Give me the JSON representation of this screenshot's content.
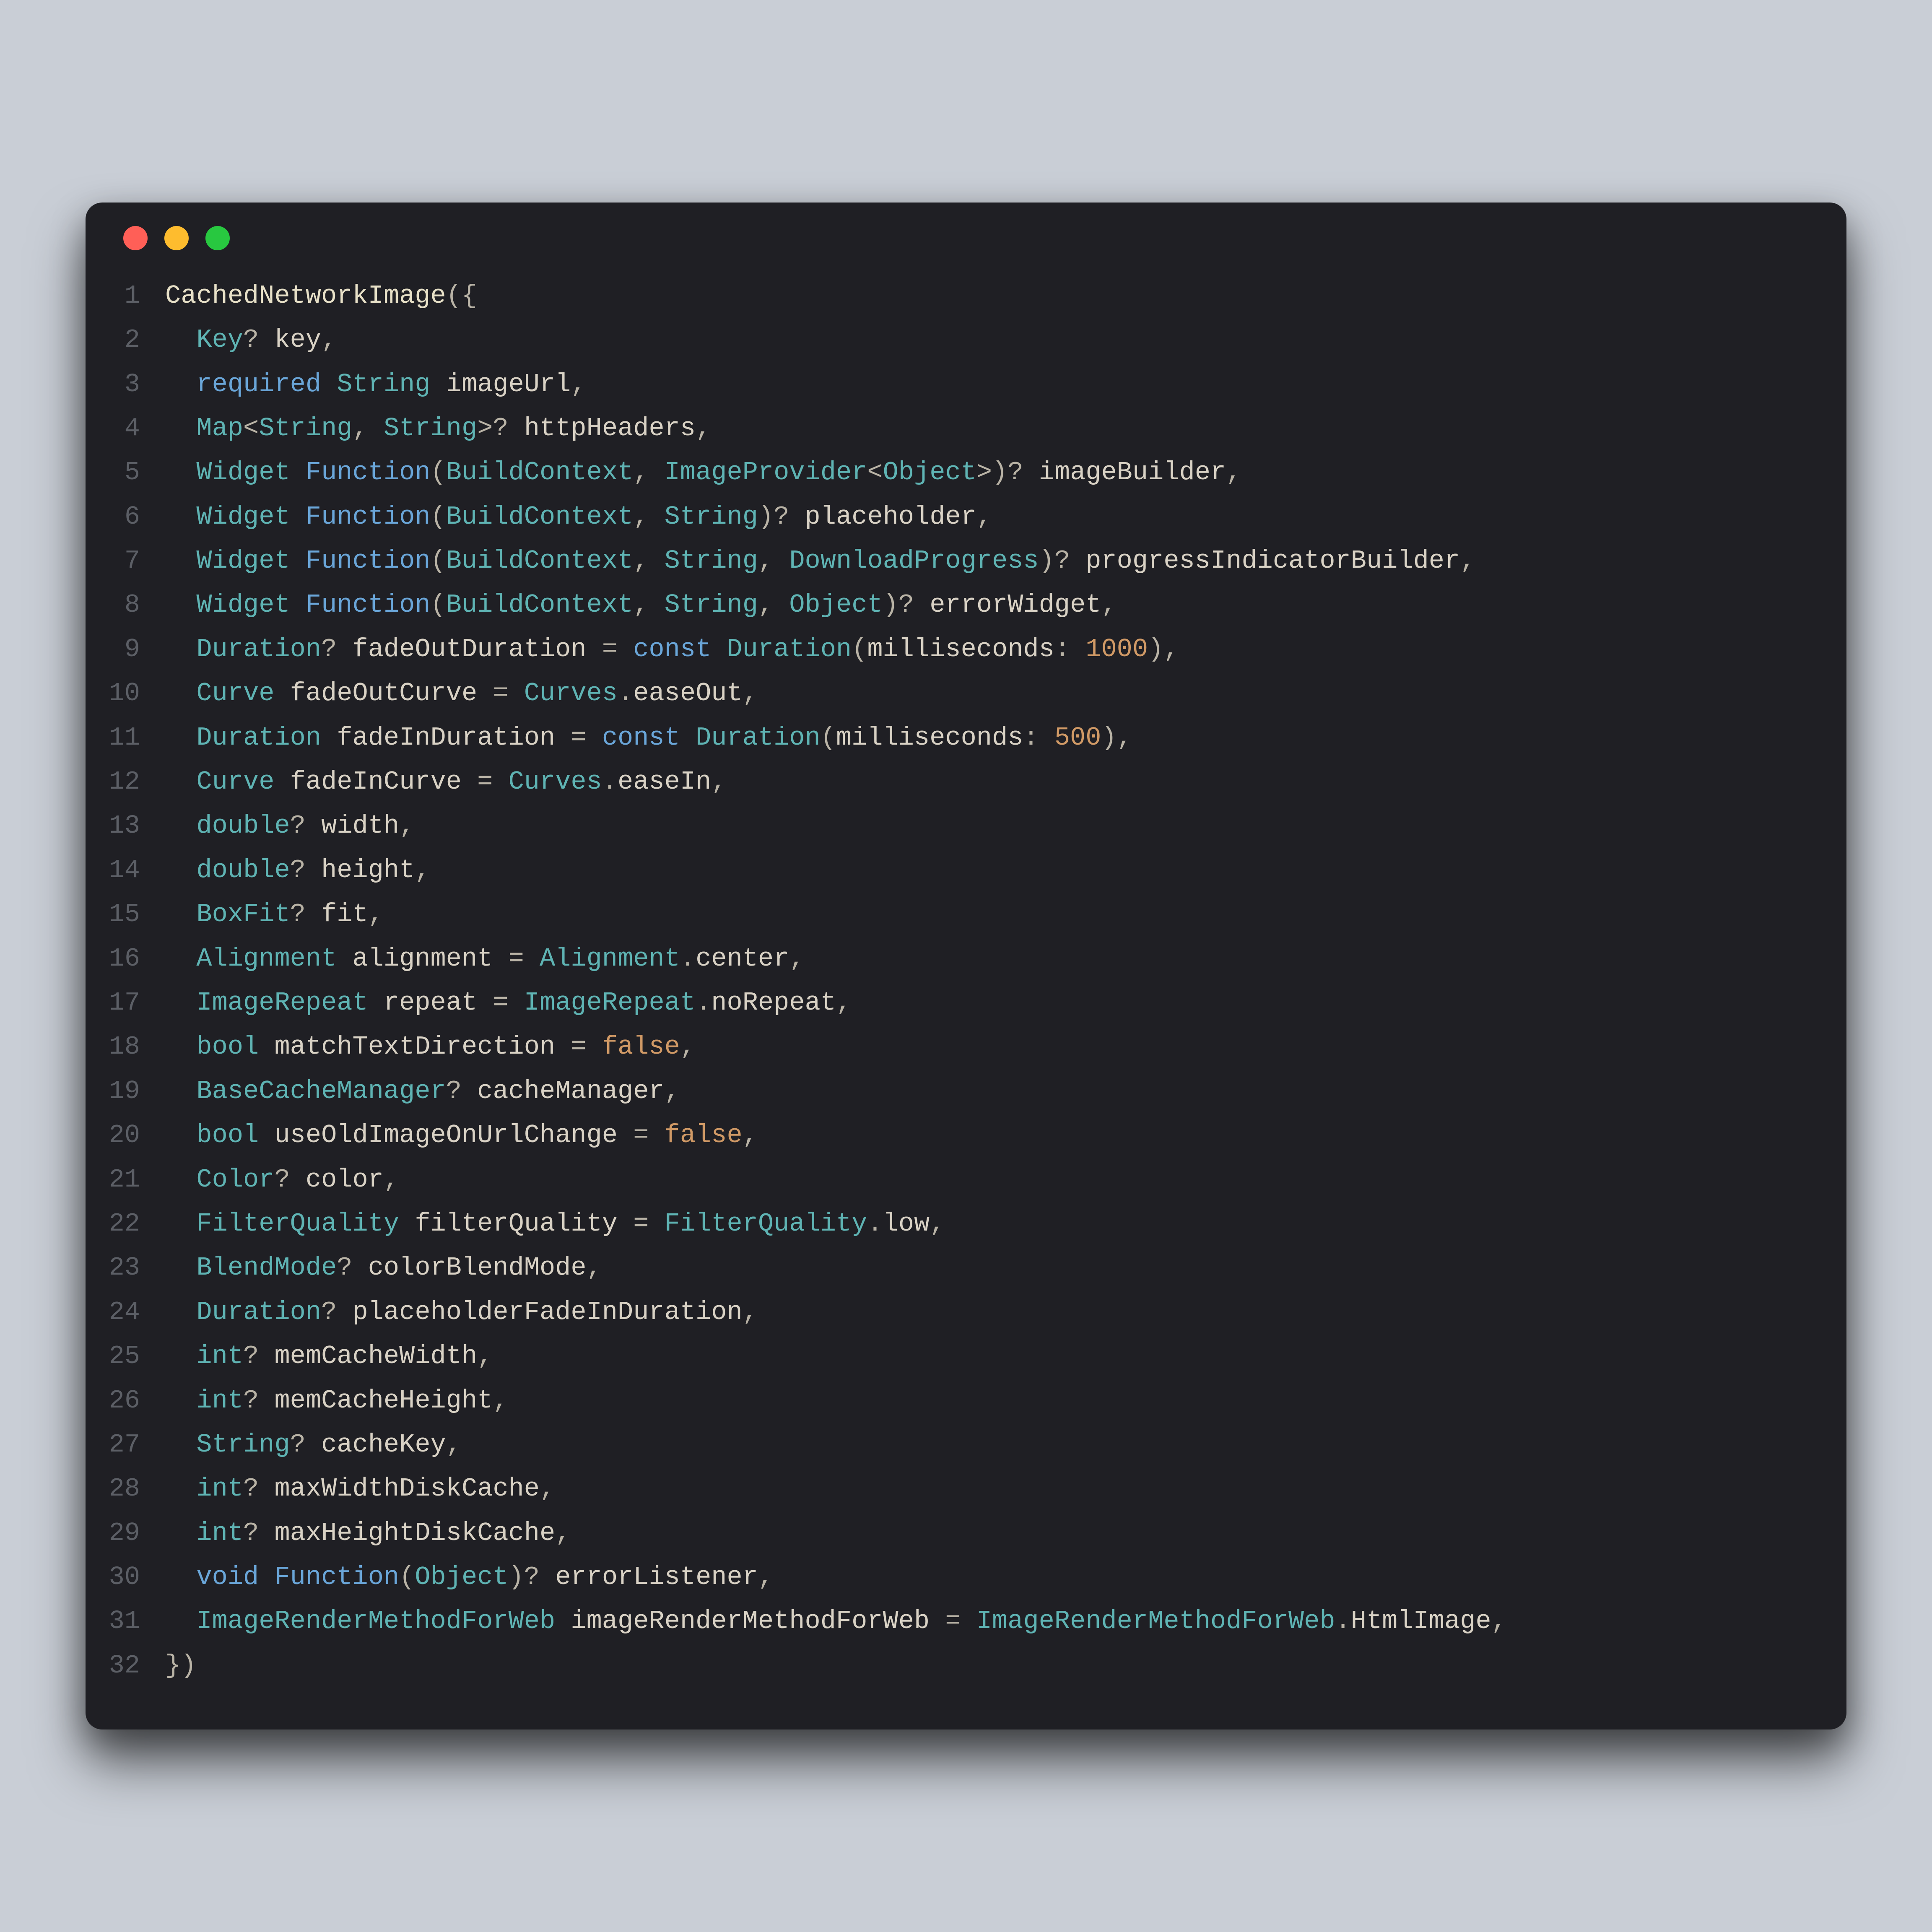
{
  "window": {
    "traffic": {
      "red": "close",
      "yellow": "minimize",
      "green": "zoom"
    }
  },
  "code": {
    "lines": [
      [
        {
          "t": "CachedNetworkImage",
          "c": "tk-head"
        },
        {
          "t": "({",
          "c": "tk-punct"
        }
      ],
      [
        {
          "t": "  ",
          "c": ""
        },
        {
          "t": "Key",
          "c": "tk-type"
        },
        {
          "t": "? ",
          "c": "tk-punct"
        },
        {
          "t": "key",
          "c": "tk-pale"
        },
        {
          "t": ",",
          "c": "tk-punct"
        }
      ],
      [
        {
          "t": "  ",
          "c": ""
        },
        {
          "t": "required",
          "c": "tk-kwreq"
        },
        {
          "t": " ",
          "c": ""
        },
        {
          "t": "String",
          "c": "tk-type"
        },
        {
          "t": " ",
          "c": ""
        },
        {
          "t": "imageUrl",
          "c": "tk-pale"
        },
        {
          "t": ",",
          "c": "tk-punct"
        }
      ],
      [
        {
          "t": "  ",
          "c": ""
        },
        {
          "t": "Map",
          "c": "tk-type"
        },
        {
          "t": "<",
          "c": "tk-punct"
        },
        {
          "t": "String",
          "c": "tk-type"
        },
        {
          "t": ", ",
          "c": "tk-punct"
        },
        {
          "t": "String",
          "c": "tk-type"
        },
        {
          "t": ">? ",
          "c": "tk-punct"
        },
        {
          "t": "httpHeaders",
          "c": "tk-pale"
        },
        {
          "t": ",",
          "c": "tk-punct"
        }
      ],
      [
        {
          "t": "  ",
          "c": ""
        },
        {
          "t": "Widget",
          "c": "tk-type"
        },
        {
          "t": " ",
          "c": ""
        },
        {
          "t": "Function",
          "c": "tk-func"
        },
        {
          "t": "(",
          "c": "tk-punct"
        },
        {
          "t": "BuildContext",
          "c": "tk-type"
        },
        {
          "t": ", ",
          "c": "tk-punct"
        },
        {
          "t": "ImageProvider",
          "c": "tk-type"
        },
        {
          "t": "<",
          "c": "tk-punct"
        },
        {
          "t": "Object",
          "c": "tk-type"
        },
        {
          "t": ">)? ",
          "c": "tk-punct"
        },
        {
          "t": "imageBuilder",
          "c": "tk-pale"
        },
        {
          "t": ",",
          "c": "tk-punct"
        }
      ],
      [
        {
          "t": "  ",
          "c": ""
        },
        {
          "t": "Widget",
          "c": "tk-type"
        },
        {
          "t": " ",
          "c": ""
        },
        {
          "t": "Function",
          "c": "tk-func"
        },
        {
          "t": "(",
          "c": "tk-punct"
        },
        {
          "t": "BuildContext",
          "c": "tk-type"
        },
        {
          "t": ", ",
          "c": "tk-punct"
        },
        {
          "t": "String",
          "c": "tk-type"
        },
        {
          "t": ")? ",
          "c": "tk-punct"
        },
        {
          "t": "placeholder",
          "c": "tk-pale"
        },
        {
          "t": ",",
          "c": "tk-punct"
        }
      ],
      [
        {
          "t": "  ",
          "c": ""
        },
        {
          "t": "Widget",
          "c": "tk-type"
        },
        {
          "t": " ",
          "c": ""
        },
        {
          "t": "Function",
          "c": "tk-func"
        },
        {
          "t": "(",
          "c": "tk-punct"
        },
        {
          "t": "BuildContext",
          "c": "tk-type"
        },
        {
          "t": ", ",
          "c": "tk-punct"
        },
        {
          "t": "String",
          "c": "tk-type"
        },
        {
          "t": ", ",
          "c": "tk-punct"
        },
        {
          "t": "DownloadProgress",
          "c": "tk-type"
        },
        {
          "t": ")? ",
          "c": "tk-punct"
        },
        {
          "t": "progressIndicatorBuilder",
          "c": "tk-pale"
        },
        {
          "t": ",",
          "c": "tk-punct"
        }
      ],
      [
        {
          "t": "  ",
          "c": ""
        },
        {
          "t": "Widget",
          "c": "tk-type"
        },
        {
          "t": " ",
          "c": ""
        },
        {
          "t": "Function",
          "c": "tk-func"
        },
        {
          "t": "(",
          "c": "tk-punct"
        },
        {
          "t": "BuildContext",
          "c": "tk-type"
        },
        {
          "t": ", ",
          "c": "tk-punct"
        },
        {
          "t": "String",
          "c": "tk-type"
        },
        {
          "t": ", ",
          "c": "tk-punct"
        },
        {
          "t": "Object",
          "c": "tk-type"
        },
        {
          "t": ")? ",
          "c": "tk-punct"
        },
        {
          "t": "errorWidget",
          "c": "tk-pale"
        },
        {
          "t": ",",
          "c": "tk-punct"
        }
      ],
      [
        {
          "t": "  ",
          "c": ""
        },
        {
          "t": "Duration",
          "c": "tk-type"
        },
        {
          "t": "? ",
          "c": "tk-punct"
        },
        {
          "t": "fadeOutDuration",
          "c": "tk-pale"
        },
        {
          "t": " = ",
          "c": "tk-punct"
        },
        {
          "t": "const",
          "c": "tk-const"
        },
        {
          "t": " ",
          "c": ""
        },
        {
          "t": "Duration",
          "c": "tk-type"
        },
        {
          "t": "(",
          "c": "tk-punct"
        },
        {
          "t": "milliseconds",
          "c": "tk-pale"
        },
        {
          "t": ": ",
          "c": "tk-punct"
        },
        {
          "t": "1000",
          "c": "tk-num"
        },
        {
          "t": "),",
          "c": "tk-punct"
        }
      ],
      [
        {
          "t": "  ",
          "c": ""
        },
        {
          "t": "Curve",
          "c": "tk-type"
        },
        {
          "t": " ",
          "c": ""
        },
        {
          "t": "fadeOutCurve",
          "c": "tk-pale"
        },
        {
          "t": " = ",
          "c": "tk-punct"
        },
        {
          "t": "Curves",
          "c": "tk-type"
        },
        {
          "t": ".",
          "c": "tk-punct"
        },
        {
          "t": "easeOut",
          "c": "tk-pale"
        },
        {
          "t": ",",
          "c": "tk-punct"
        }
      ],
      [
        {
          "t": "  ",
          "c": ""
        },
        {
          "t": "Duration",
          "c": "tk-type"
        },
        {
          "t": " ",
          "c": ""
        },
        {
          "t": "fadeInDuration",
          "c": "tk-pale"
        },
        {
          "t": " = ",
          "c": "tk-punct"
        },
        {
          "t": "const",
          "c": "tk-const"
        },
        {
          "t": " ",
          "c": ""
        },
        {
          "t": "Duration",
          "c": "tk-type"
        },
        {
          "t": "(",
          "c": "tk-punct"
        },
        {
          "t": "milliseconds",
          "c": "tk-pale"
        },
        {
          "t": ": ",
          "c": "tk-punct"
        },
        {
          "t": "500",
          "c": "tk-num"
        },
        {
          "t": "),",
          "c": "tk-punct"
        }
      ],
      [
        {
          "t": "  ",
          "c": ""
        },
        {
          "t": "Curve",
          "c": "tk-type"
        },
        {
          "t": " ",
          "c": ""
        },
        {
          "t": "fadeInCurve",
          "c": "tk-pale"
        },
        {
          "t": " = ",
          "c": "tk-punct"
        },
        {
          "t": "Curves",
          "c": "tk-type"
        },
        {
          "t": ".",
          "c": "tk-punct"
        },
        {
          "t": "easeIn",
          "c": "tk-pale"
        },
        {
          "t": ",",
          "c": "tk-punct"
        }
      ],
      [
        {
          "t": "  ",
          "c": ""
        },
        {
          "t": "double",
          "c": "tk-type"
        },
        {
          "t": "? ",
          "c": "tk-punct"
        },
        {
          "t": "width",
          "c": "tk-pale"
        },
        {
          "t": ",",
          "c": "tk-punct"
        }
      ],
      [
        {
          "t": "  ",
          "c": ""
        },
        {
          "t": "double",
          "c": "tk-type"
        },
        {
          "t": "? ",
          "c": "tk-punct"
        },
        {
          "t": "height",
          "c": "tk-pale"
        },
        {
          "t": ",",
          "c": "tk-punct"
        }
      ],
      [
        {
          "t": "  ",
          "c": ""
        },
        {
          "t": "BoxFit",
          "c": "tk-type"
        },
        {
          "t": "? ",
          "c": "tk-punct"
        },
        {
          "t": "fit",
          "c": "tk-pale"
        },
        {
          "t": ",",
          "c": "tk-punct"
        }
      ],
      [
        {
          "t": "  ",
          "c": ""
        },
        {
          "t": "Alignment",
          "c": "tk-type"
        },
        {
          "t": " ",
          "c": ""
        },
        {
          "t": "alignment",
          "c": "tk-pale"
        },
        {
          "t": " = ",
          "c": "tk-punct"
        },
        {
          "t": "Alignment",
          "c": "tk-type"
        },
        {
          "t": ".",
          "c": "tk-punct"
        },
        {
          "t": "center",
          "c": "tk-pale"
        },
        {
          "t": ",",
          "c": "tk-punct"
        }
      ],
      [
        {
          "t": "  ",
          "c": ""
        },
        {
          "t": "ImageRepeat",
          "c": "tk-type"
        },
        {
          "t": " ",
          "c": ""
        },
        {
          "t": "repeat",
          "c": "tk-pale"
        },
        {
          "t": " = ",
          "c": "tk-punct"
        },
        {
          "t": "ImageRepeat",
          "c": "tk-type"
        },
        {
          "t": ".",
          "c": "tk-punct"
        },
        {
          "t": "noRepeat",
          "c": "tk-pale"
        },
        {
          "t": ",",
          "c": "tk-punct"
        }
      ],
      [
        {
          "t": "  ",
          "c": ""
        },
        {
          "t": "bool",
          "c": "tk-type"
        },
        {
          "t": " ",
          "c": ""
        },
        {
          "t": "matchTextDirection",
          "c": "tk-pale"
        },
        {
          "t": " = ",
          "c": "tk-punct"
        },
        {
          "t": "false",
          "c": "tk-bool"
        },
        {
          "t": ",",
          "c": "tk-punct"
        }
      ],
      [
        {
          "t": "  ",
          "c": ""
        },
        {
          "t": "BaseCacheManager",
          "c": "tk-type"
        },
        {
          "t": "? ",
          "c": "tk-punct"
        },
        {
          "t": "cacheManager",
          "c": "tk-pale"
        },
        {
          "t": ",",
          "c": "tk-punct"
        }
      ],
      [
        {
          "t": "  ",
          "c": ""
        },
        {
          "t": "bool",
          "c": "tk-type"
        },
        {
          "t": " ",
          "c": ""
        },
        {
          "t": "useOldImageOnUrlChange",
          "c": "tk-pale"
        },
        {
          "t": " = ",
          "c": "tk-punct"
        },
        {
          "t": "false",
          "c": "tk-bool"
        },
        {
          "t": ",",
          "c": "tk-punct"
        }
      ],
      [
        {
          "t": "  ",
          "c": ""
        },
        {
          "t": "Color",
          "c": "tk-type"
        },
        {
          "t": "? ",
          "c": "tk-punct"
        },
        {
          "t": "color",
          "c": "tk-pale"
        },
        {
          "t": ",",
          "c": "tk-punct"
        }
      ],
      [
        {
          "t": "  ",
          "c": ""
        },
        {
          "t": "FilterQuality",
          "c": "tk-type"
        },
        {
          "t": " ",
          "c": ""
        },
        {
          "t": "filterQuality",
          "c": "tk-pale"
        },
        {
          "t": " = ",
          "c": "tk-punct"
        },
        {
          "t": "FilterQuality",
          "c": "tk-type"
        },
        {
          "t": ".",
          "c": "tk-punct"
        },
        {
          "t": "low",
          "c": "tk-pale"
        },
        {
          "t": ",",
          "c": "tk-punct"
        }
      ],
      [
        {
          "t": "  ",
          "c": ""
        },
        {
          "t": "BlendMode",
          "c": "tk-type"
        },
        {
          "t": "? ",
          "c": "tk-punct"
        },
        {
          "t": "colorBlendMode",
          "c": "tk-pale"
        },
        {
          "t": ",",
          "c": "tk-punct"
        }
      ],
      [
        {
          "t": "  ",
          "c": ""
        },
        {
          "t": "Duration",
          "c": "tk-type"
        },
        {
          "t": "? ",
          "c": "tk-punct"
        },
        {
          "t": "placeholderFadeInDuration",
          "c": "tk-pale"
        },
        {
          "t": ",",
          "c": "tk-punct"
        }
      ],
      [
        {
          "t": "  ",
          "c": ""
        },
        {
          "t": "int",
          "c": "tk-type"
        },
        {
          "t": "? ",
          "c": "tk-punct"
        },
        {
          "t": "memCacheWidth",
          "c": "tk-pale"
        },
        {
          "t": ",",
          "c": "tk-punct"
        }
      ],
      [
        {
          "t": "  ",
          "c": ""
        },
        {
          "t": "int",
          "c": "tk-type"
        },
        {
          "t": "? ",
          "c": "tk-punct"
        },
        {
          "t": "memCacheHeight",
          "c": "tk-pale"
        },
        {
          "t": ",",
          "c": "tk-punct"
        }
      ],
      [
        {
          "t": "  ",
          "c": ""
        },
        {
          "t": "String",
          "c": "tk-type"
        },
        {
          "t": "? ",
          "c": "tk-punct"
        },
        {
          "t": "cacheKey",
          "c": "tk-pale"
        },
        {
          "t": ",",
          "c": "tk-punct"
        }
      ],
      [
        {
          "t": "  ",
          "c": ""
        },
        {
          "t": "int",
          "c": "tk-type"
        },
        {
          "t": "? ",
          "c": "tk-punct"
        },
        {
          "t": "maxWidthDiskCache",
          "c": "tk-pale"
        },
        {
          "t": ",",
          "c": "tk-punct"
        }
      ],
      [
        {
          "t": "  ",
          "c": ""
        },
        {
          "t": "int",
          "c": "tk-type"
        },
        {
          "t": "? ",
          "c": "tk-punct"
        },
        {
          "t": "maxHeightDiskCache",
          "c": "tk-pale"
        },
        {
          "t": ",",
          "c": "tk-punct"
        }
      ],
      [
        {
          "t": "  ",
          "c": ""
        },
        {
          "t": "void",
          "c": "tk-kwvoid"
        },
        {
          "t": " ",
          "c": ""
        },
        {
          "t": "Function",
          "c": "tk-func"
        },
        {
          "t": "(",
          "c": "tk-punct"
        },
        {
          "t": "Object",
          "c": "tk-type"
        },
        {
          "t": ")? ",
          "c": "tk-punct"
        },
        {
          "t": "errorListener",
          "c": "tk-pale"
        },
        {
          "t": ",",
          "c": "tk-punct"
        }
      ],
      [
        {
          "t": "  ",
          "c": ""
        },
        {
          "t": "ImageRenderMethodForWeb",
          "c": "tk-type"
        },
        {
          "t": " ",
          "c": ""
        },
        {
          "t": "imageRenderMethodForWeb",
          "c": "tk-pale"
        },
        {
          "t": " = ",
          "c": "tk-punct"
        },
        {
          "t": "ImageRenderMethodForWeb",
          "c": "tk-type"
        },
        {
          "t": ".",
          "c": "tk-punct"
        },
        {
          "t": "HtmlImage",
          "c": "tk-pale"
        },
        {
          "t": ",",
          "c": "tk-punct"
        }
      ],
      [
        {
          "t": "})",
          "c": "tk-punct"
        }
      ]
    ]
  }
}
